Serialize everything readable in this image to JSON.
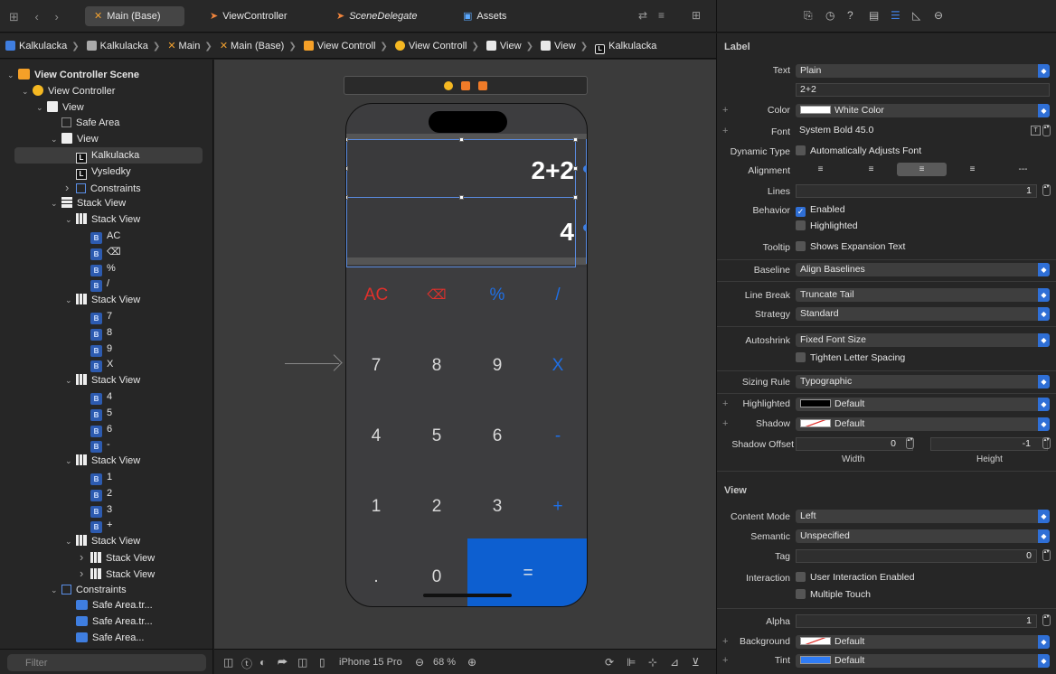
{
  "tabs": [
    {
      "label": "Main (Base)",
      "icon": "storyboard-icon",
      "active": true
    },
    {
      "label": "ViewController",
      "icon": "swift-icon",
      "active": false
    },
    {
      "label": "SceneDelegate",
      "icon": "swift-icon",
      "active": false,
      "italic": true
    },
    {
      "label": "Assets",
      "icon": "assets-icon",
      "active": false
    }
  ],
  "breadcrumb": [
    "Kalkulacka",
    "Kalkulacka",
    "Main",
    "Main (Base)",
    "View Controll",
    "View Controll",
    "View",
    "View",
    "Kalkulacka"
  ],
  "navigator": {
    "rows": [
      {
        "label": "View Controller Scene",
        "level": 0,
        "icon": "scene",
        "chev": "v"
      },
      {
        "label": "View Controller",
        "level": 1,
        "icon": "vc",
        "chev": "v"
      },
      {
        "label": "View",
        "level": 2,
        "icon": "whsq",
        "chev": "v"
      },
      {
        "label": "Safe Area",
        "level": 3,
        "icon": "dsq",
        "chev": ""
      },
      {
        "label": "View",
        "level": 3,
        "icon": "whsq",
        "chev": "v"
      },
      {
        "label": "Kalkulacka",
        "level": 4,
        "icon": "L",
        "chev": "",
        "selected": true
      },
      {
        "label": "Vysledky",
        "level": 4,
        "icon": "L",
        "chev": ""
      },
      {
        "label": "Constraints",
        "level": 4,
        "icon": "cons",
        "chev": ">"
      },
      {
        "label": "Stack View",
        "level": 3,
        "icon": "stkv",
        "chev": "v"
      },
      {
        "label": "Stack View",
        "level": 4,
        "icon": "stk",
        "chev": "v"
      },
      {
        "label": "AC",
        "level": 5,
        "icon": "b",
        "chev": ""
      },
      {
        "label": "⌫",
        "level": 5,
        "icon": "b",
        "chev": ""
      },
      {
        "label": "%",
        "level": 5,
        "icon": "b",
        "chev": ""
      },
      {
        "label": "/",
        "level": 5,
        "icon": "b",
        "chev": ""
      },
      {
        "label": "Stack View",
        "level": 4,
        "icon": "stk",
        "chev": "v"
      },
      {
        "label": "7",
        "level": 5,
        "icon": "b",
        "chev": ""
      },
      {
        "label": "8",
        "level": 5,
        "icon": "b",
        "chev": ""
      },
      {
        "label": "9",
        "level": 5,
        "icon": "b",
        "chev": ""
      },
      {
        "label": "X",
        "level": 5,
        "icon": "b",
        "chev": ""
      },
      {
        "label": "Stack View",
        "level": 4,
        "icon": "stk",
        "chev": "v"
      },
      {
        "label": "4",
        "level": 5,
        "icon": "b",
        "chev": ""
      },
      {
        "label": "5",
        "level": 5,
        "icon": "b",
        "chev": ""
      },
      {
        "label": "6",
        "level": 5,
        "icon": "b",
        "chev": ""
      },
      {
        "label": "-",
        "level": 5,
        "icon": "b",
        "chev": ""
      },
      {
        "label": "Stack View",
        "level": 4,
        "icon": "stk",
        "chev": "v"
      },
      {
        "label": "1",
        "level": 5,
        "icon": "b",
        "chev": ""
      },
      {
        "label": "2",
        "level": 5,
        "icon": "b",
        "chev": ""
      },
      {
        "label": "3",
        "level": 5,
        "icon": "b",
        "chev": ""
      },
      {
        "label": "+",
        "level": 5,
        "icon": "b",
        "chev": ""
      },
      {
        "label": "Stack View",
        "level": 4,
        "icon": "stk",
        "chev": "v"
      },
      {
        "label": "Stack View",
        "level": 5,
        "icon": "stk",
        "chev": ">"
      },
      {
        "label": "Stack View",
        "level": 5,
        "icon": "stk",
        "chev": ">"
      },
      {
        "label": "Constraints",
        "level": 3,
        "icon": "cons",
        "chev": "v"
      },
      {
        "label": "Safe Area.tr...",
        "level": 4,
        "icon": "sa",
        "chev": ""
      },
      {
        "label": "Safe Area.tr...",
        "level": 4,
        "icon": "sa",
        "chev": ""
      },
      {
        "label": "Safe Area...",
        "level": 4,
        "icon": "sa",
        "chev": ""
      }
    ],
    "filter_placeholder": "Filter"
  },
  "canvas": {
    "expression": "2+2",
    "result": "4",
    "keys": [
      {
        "label": "AC",
        "style": "red"
      },
      {
        "label": "⌫",
        "style": "red"
      },
      {
        "label": "%",
        "style": "blue"
      },
      {
        "label": "/",
        "style": "blue"
      },
      {
        "label": "7",
        "style": ""
      },
      {
        "label": "8",
        "style": ""
      },
      {
        "label": "9",
        "style": ""
      },
      {
        "label": "X",
        "style": "blue"
      },
      {
        "label": "4",
        "style": ""
      },
      {
        "label": "5",
        "style": ""
      },
      {
        "label": "6",
        "style": ""
      },
      {
        "label": "-",
        "style": "blue"
      },
      {
        "label": "1",
        "style": ""
      },
      {
        "label": "2",
        "style": ""
      },
      {
        "label": "3",
        "style": ""
      },
      {
        "label": "+",
        "style": "blue"
      },
      {
        "label": ".",
        "style": ""
      },
      {
        "label": "0",
        "style": ""
      },
      {
        "label": "=",
        "style": "eq"
      }
    ],
    "device": "iPhone 15 Pro",
    "zoom": "68 %"
  },
  "inspector": {
    "label_section": "Label",
    "text_label": "Text",
    "text_value": "Plain",
    "text_content": "2+2",
    "color_label": "Color",
    "color_value": "White Color",
    "font_label": "Font",
    "font_value": "System Bold 45.0",
    "dynamic_type_label": "Dynamic Type",
    "dynamic_type_value": "Automatically Adjusts Font",
    "alignment_label": "Alignment",
    "lines_label": "Lines",
    "lines_value": "1",
    "behavior_label": "Behavior",
    "behavior_enabled": "Enabled",
    "behavior_highlighted": "Highlighted",
    "tooltip_label": "Tooltip",
    "tooltip_value": "Shows Expansion Text",
    "baseline_label": "Baseline",
    "baseline_value": "Align Baselines",
    "linebreak_label": "Line Break",
    "linebreak_value": "Truncate Tail",
    "strategy_label": "Strategy",
    "strategy_value": "Standard",
    "autoshrink_label": "Autoshrink",
    "autoshrink_value": "Fixed Font Size",
    "tighten_value": "Tighten Letter Spacing",
    "sizing_label": "Sizing Rule",
    "sizing_value": "Typographic",
    "highlighted_label": "Highlighted",
    "highlighted_value": "Default",
    "shadow_label": "Shadow",
    "shadow_value": "Default",
    "shadow_offset_label": "Shadow Offset",
    "shadow_w": "0",
    "shadow_h": "-1",
    "width_label": "Width",
    "height_label": "Height",
    "view_section": "View",
    "content_mode_label": "Content Mode",
    "content_mode_value": "Left",
    "semantic_label": "Semantic",
    "semantic_value": "Unspecified",
    "tag_label": "Tag",
    "tag_value": "0",
    "interaction_label": "Interaction",
    "interaction_uie": "User Interaction Enabled",
    "interaction_mt": "Multiple Touch",
    "alpha_label": "Alpha",
    "alpha_value": "1",
    "background_label": "Background",
    "background_value": "Default",
    "tint_label": "Tint",
    "tint_value": "Default"
  }
}
